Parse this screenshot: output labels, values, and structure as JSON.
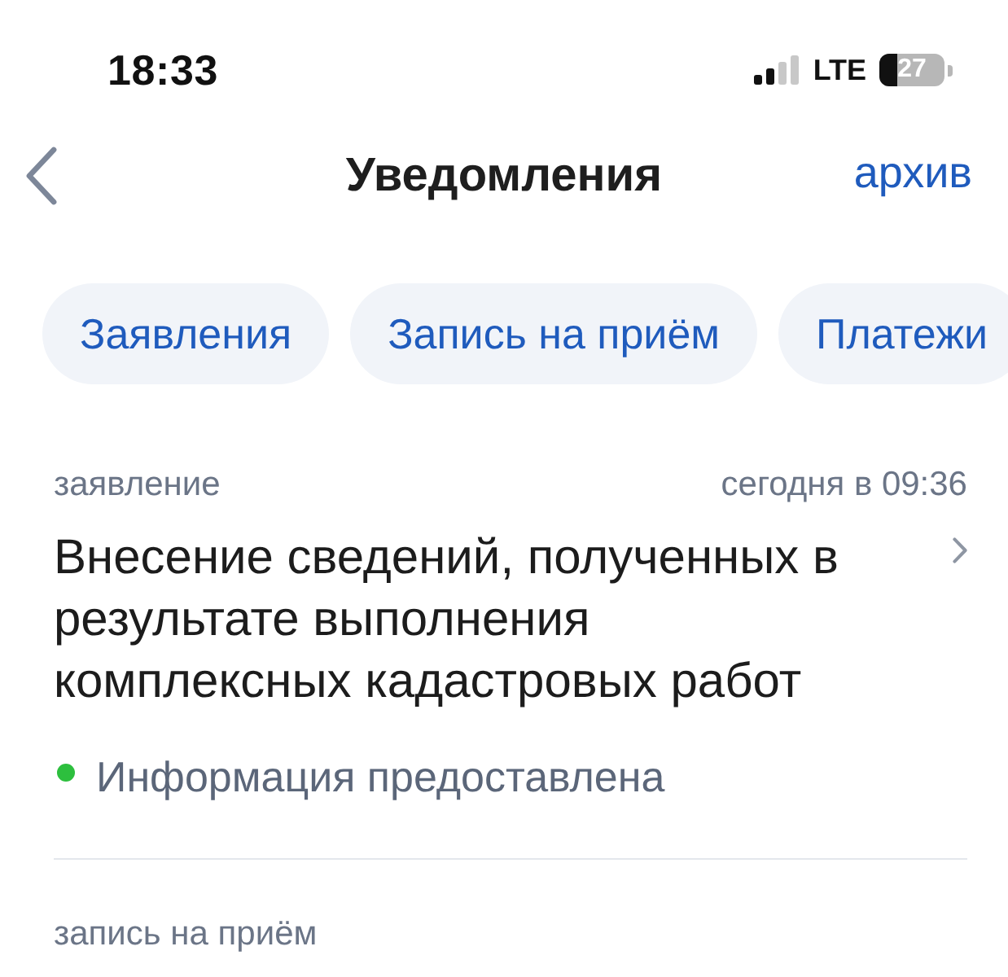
{
  "status_bar": {
    "time": "18:33",
    "network": "LTE",
    "battery": "27"
  },
  "header": {
    "title": "Уведомления",
    "action": "архив"
  },
  "tabs": [
    {
      "label": "Заявления",
      "selected": false
    },
    {
      "label": "Запись на приём",
      "selected": false
    },
    {
      "label": "Платежи",
      "selected": false
    }
  ],
  "notifications": [
    {
      "category": "заявление",
      "time": "сегодня в 09:36",
      "title": "Внесение сведений, полученных в результате выполнения комплексных кадастровых работ",
      "status": "Информация предоставлена",
      "color": "#2dbf3e"
    },
    {
      "category": "запись на приём"
    }
  ]
}
